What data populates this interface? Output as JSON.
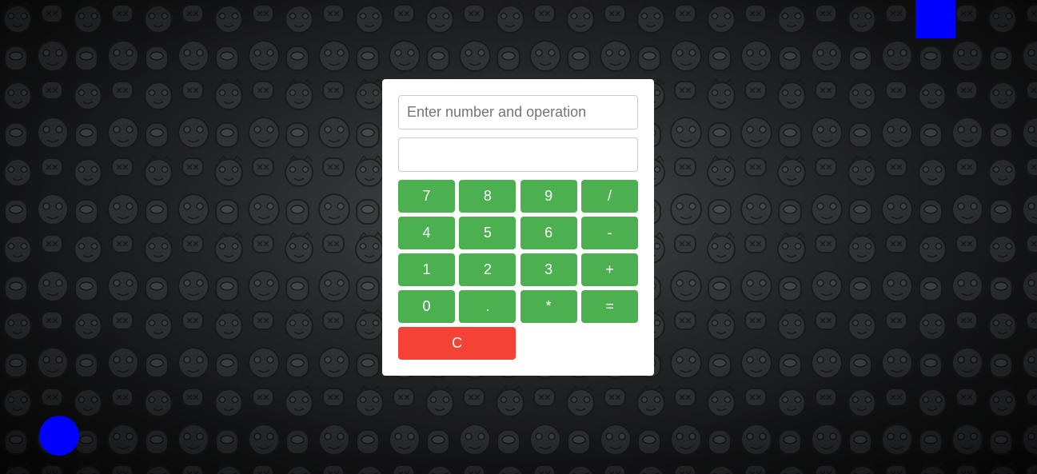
{
  "colors": {
    "key_green": "#4caf50",
    "key_clear_red": "#f44336",
    "marker_blue": "#0000ff"
  },
  "background": {
    "icon": "cartoon-character-pattern"
  },
  "calculator": {
    "expression_input": {
      "value": "",
      "placeholder": "Enter number and operation"
    },
    "result_field": {
      "value": "",
      "placeholder": ""
    },
    "keys": [
      {
        "label": "7",
        "name": "key-7"
      },
      {
        "label": "8",
        "name": "key-8"
      },
      {
        "label": "9",
        "name": "key-9"
      },
      {
        "label": "/",
        "name": "key-divide"
      },
      {
        "label": "4",
        "name": "key-4"
      },
      {
        "label": "5",
        "name": "key-5"
      },
      {
        "label": "6",
        "name": "key-6"
      },
      {
        "label": "-",
        "name": "key-subtract"
      },
      {
        "label": "1",
        "name": "key-1"
      },
      {
        "label": "2",
        "name": "key-2"
      },
      {
        "label": "3",
        "name": "key-3"
      },
      {
        "label": "+",
        "name": "key-add"
      },
      {
        "label": "0",
        "name": "key-0"
      },
      {
        "label": ".",
        "name": "key-decimal"
      },
      {
        "label": "*",
        "name": "key-multiply"
      },
      {
        "label": "=",
        "name": "key-equals"
      }
    ],
    "clear_label": "C"
  }
}
